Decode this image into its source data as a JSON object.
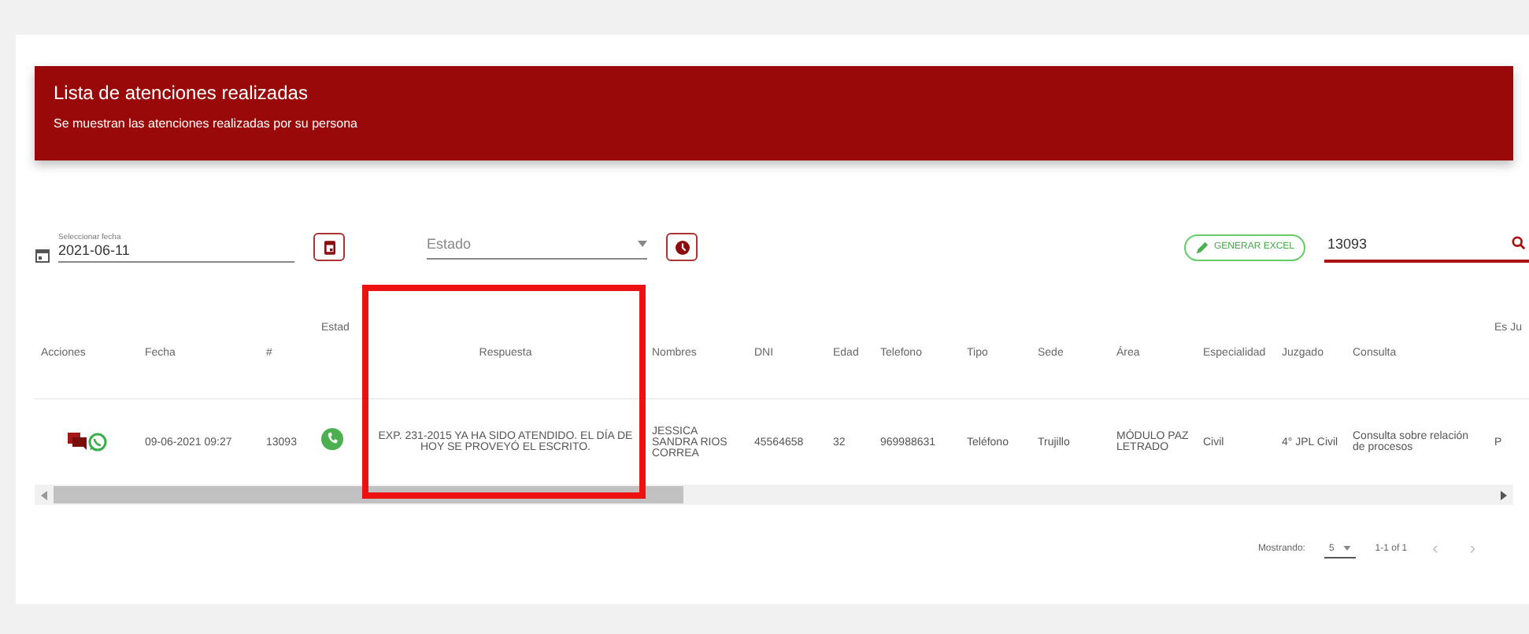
{
  "header": {
    "title": "Lista de atenciones realizadas",
    "subtitle": "Se muestran las atenciones realizadas por su persona"
  },
  "filters": {
    "date": {
      "label": "Seleccionar fecha",
      "value": "2021-06-11"
    },
    "status": {
      "placeholder": "Estado"
    },
    "export_button": "GENERAR EXCEL",
    "search": {
      "value": "13093"
    }
  },
  "table": {
    "columns": [
      "Acciones",
      "Fecha",
      "#",
      "Estad",
      "Respuesta",
      "Nombres",
      "DNI",
      "Edad",
      "Telefono",
      "Tipo",
      "Sede",
      "Área",
      "Especialidad",
      "Juzgado",
      "Consulta",
      "Es Ju"
    ],
    "rows": [
      {
        "cells": [
          "",
          "09-06-2021 09:27",
          "13093",
          "",
          "EXP. 231-2015 YA HA SIDO ATENDIDO. EL DÍA DE HOY SE PROVEYÓ EL ESCRITO.",
          "JESSICA SANDRA RIOS CORREA",
          "45564658",
          "32",
          "969988631",
          "Teléfono",
          "Trujillo",
          "MÓDULO PAZ LETRADO",
          "Civil",
          "4° JPL Civil",
          "Consulta sobre relación de procesos",
          "P"
        ]
      }
    ]
  },
  "pagination": {
    "label": "Mostrando:",
    "page_size": "5",
    "range": "1-1 of 1",
    "prev": "‹",
    "next": "›"
  }
}
